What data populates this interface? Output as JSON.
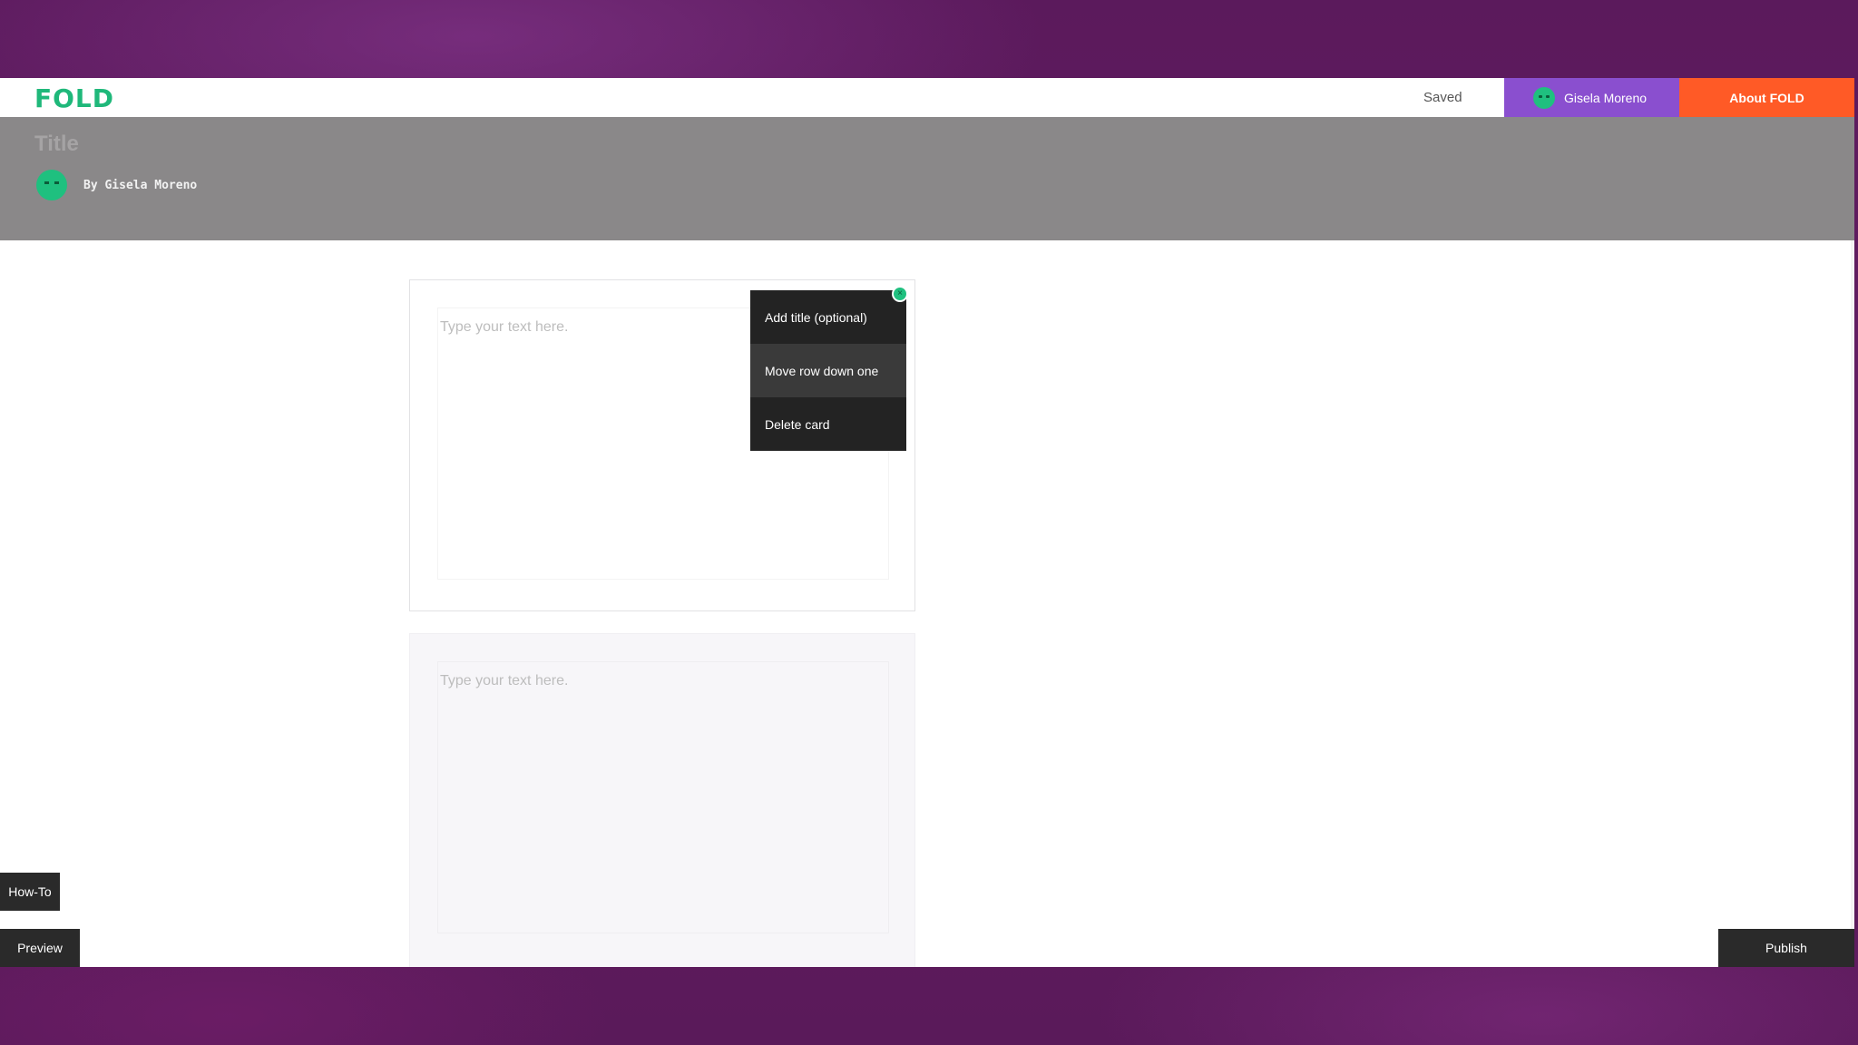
{
  "app": {
    "logo": "FOLD",
    "brand_color": "#1fb87a"
  },
  "topbar": {
    "status": "Saved",
    "user_name": "Gisela Moreno",
    "about_label": "About FOLD",
    "user_color": "#8a4fcf",
    "about_color": "#ff5a26"
  },
  "story": {
    "title": "Title",
    "byline": "By Gisela Moreno"
  },
  "cards": [
    {
      "placeholder": "Type your text here."
    },
    {
      "placeholder": "Type your text here."
    }
  ],
  "card_menu": {
    "items": [
      {
        "label": "Add title (optional)"
      },
      {
        "label": "Move row down one",
        "highlighted": true
      },
      {
        "label": "Delete card"
      }
    ],
    "close_icon": "close-icon"
  },
  "footer": {
    "howto_label": "How-To",
    "preview_label": "Preview",
    "publish_label": "Publish"
  },
  "icons": {
    "avatar": "avatar-icon"
  }
}
